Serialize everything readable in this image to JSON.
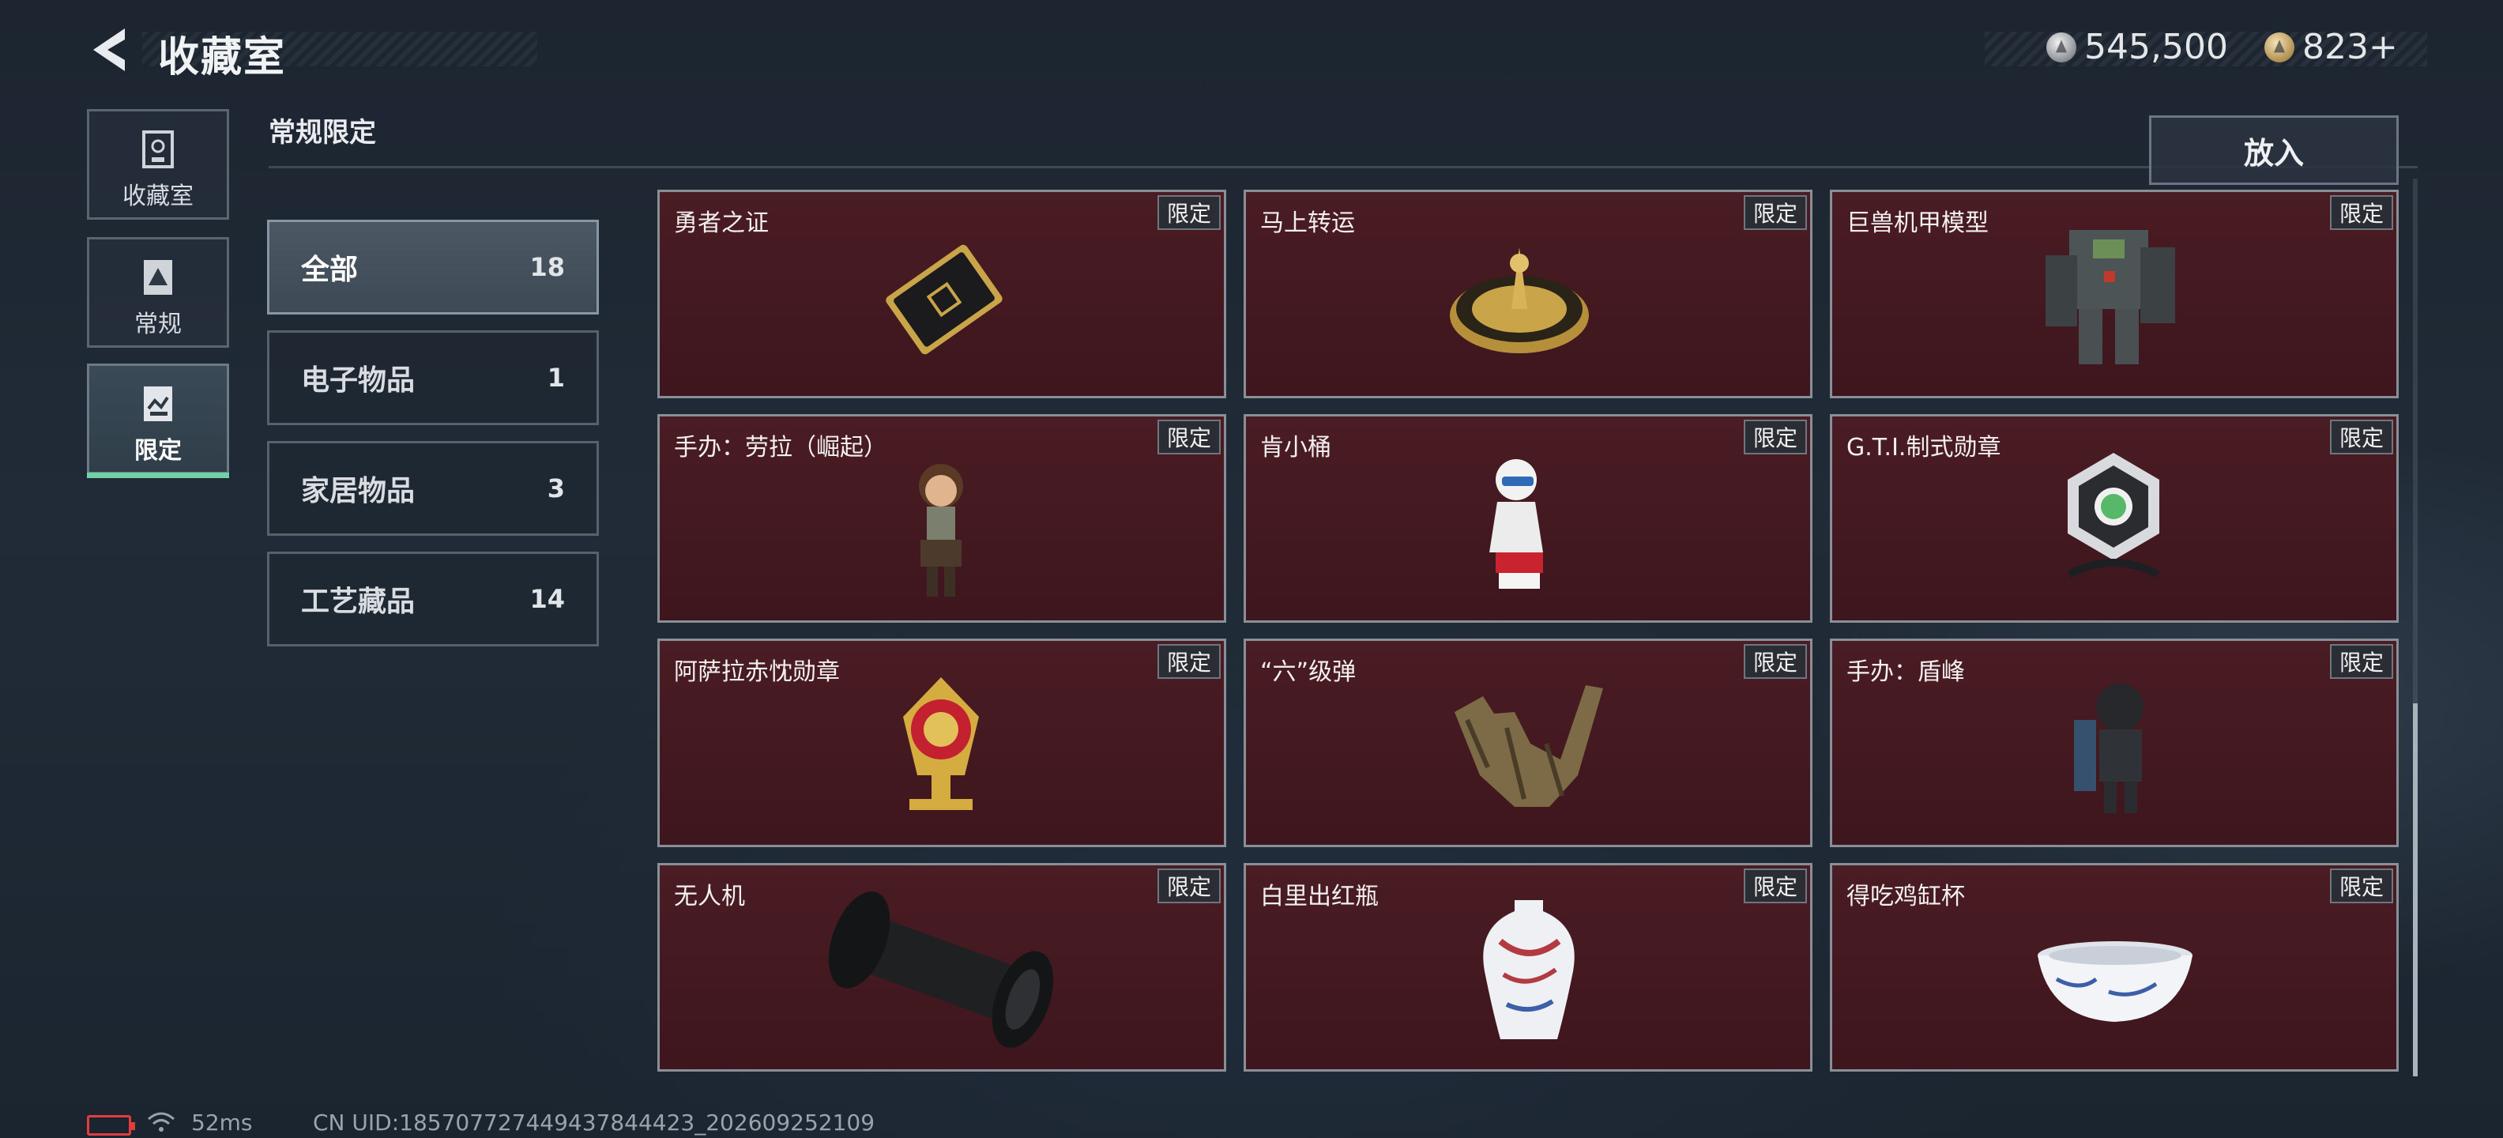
{
  "header": {
    "title": "收藏室",
    "currency_silver": "545,500",
    "currency_gold": "823+"
  },
  "nav": [
    {
      "label": "收藏室",
      "icon": "collection-icon"
    },
    {
      "label": "常规",
      "icon": "regular-icon"
    },
    {
      "label": "限定",
      "icon": "limited-icon",
      "active": true
    }
  ],
  "section_title": "常规限定",
  "categories": [
    {
      "name": "全部",
      "count": "18",
      "active": true
    },
    {
      "name": "电子物品",
      "count": "1"
    },
    {
      "name": "家居物品",
      "count": "3"
    },
    {
      "name": "工艺藏品",
      "count": "14"
    }
  ],
  "put_in_label": "放入",
  "badge_label": "限定",
  "items": [
    {
      "name": "勇者之证",
      "icon": "card-icon"
    },
    {
      "name": "马上转运",
      "icon": "spinner-icon"
    },
    {
      "name": "巨兽机甲模型",
      "icon": "mech-icon"
    },
    {
      "name": "手办：劳拉（崛起）",
      "icon": "figure-lara-icon"
    },
    {
      "name": "肯小桶",
      "icon": "figure-kfc-icon"
    },
    {
      "name": "G.T.I.制式勋章",
      "icon": "gti-medal-icon"
    },
    {
      "name": "阿萨拉赤忱勋章",
      "icon": "asala-medal-icon"
    },
    {
      "name": "“六”级弹",
      "icon": "bullet-hand-icon"
    },
    {
      "name": "手办：盾峰",
      "icon": "figure-shield-icon"
    },
    {
      "name": "无人机",
      "icon": "drone-icon"
    },
    {
      "name": "白里出红瓶",
      "icon": "vase-icon"
    },
    {
      "name": "得吃鸡缸杯",
      "icon": "cup-icon"
    }
  ],
  "status": {
    "ping": "52ms",
    "uid": "CN UID:185707727449437844423_202609252109"
  },
  "colors": {
    "card_bg": "#4a1c24",
    "accent_green": "#6fd3a6",
    "battery_red": "#e23c3c"
  }
}
